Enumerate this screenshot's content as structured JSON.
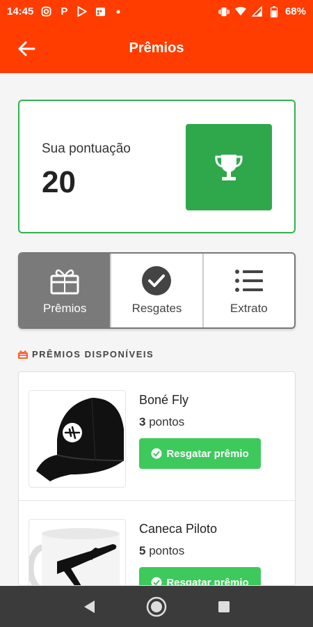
{
  "status_bar": {
    "time": "14:45",
    "battery": "68%",
    "icons": [
      "instagram-icon",
      "pinterest-icon",
      "play-store-icon",
      "calendar-icon",
      "dot-icon",
      "vibrate-icon",
      "wifi-icon",
      "signal-icon",
      "battery-icon"
    ]
  },
  "app_bar": {
    "title": "Prêmios",
    "back_icon": "arrow-left-icon"
  },
  "score": {
    "label": "Sua pontuação",
    "value": "20",
    "icon": "trophy-icon",
    "colors": {
      "border": "#2fb34e",
      "box": "#2ea84a"
    }
  },
  "tabs": [
    {
      "label": "Prêmios",
      "icon": "gift-icon",
      "active": true
    },
    {
      "label": "Resgates",
      "icon": "check-circle-icon",
      "active": false
    },
    {
      "label": "Extrato",
      "icon": "list-icon",
      "active": false
    }
  ],
  "section": {
    "title": "PRÊMIOS DISPONÍVEIS",
    "icon": "gift-small-icon"
  },
  "prizes": [
    {
      "name": "Boné Fly",
      "points": "3",
      "points_unit": "pontos",
      "button": "Resgatar prêmio",
      "image": "black-cap-with-plane-logo"
    },
    {
      "name": "Caneca Piloto",
      "points": "5",
      "points_unit": "pontos",
      "button": "Resgatar prêmio",
      "image": "white-mug-with-plane"
    }
  ],
  "nav": [
    "back-triangle-icon",
    "home-circle-icon",
    "recents-square-icon"
  ],
  "colors": {
    "accent": "#ff3d00",
    "green": "#3ec95c",
    "tab_active": "#7a7a7a"
  }
}
